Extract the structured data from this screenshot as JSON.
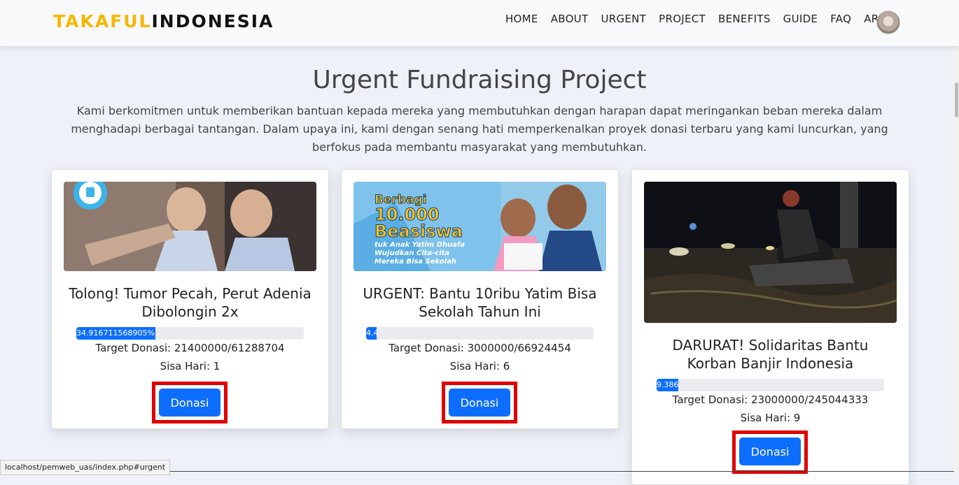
{
  "brand": {
    "part1": "TAKAFUL",
    "part2": "INDONESIA"
  },
  "nav": [
    "HOME",
    "ABOUT",
    "URGENT",
    "PROJECT",
    "BENEFITS",
    "GUIDE",
    "FAQ",
    "ARIMA"
  ],
  "hero": {
    "title": "Urgent Fundraising Project",
    "description": "Kami berkomitmen untuk memberikan bantuan kepada mereka yang membutuhkan dengan harapan dapat meringankan beban mereka dalam menghadapi berbagai tantangan. Dalam upaya ini, kami dengan senang hati memperkenalkan proyek donasi terbaru yang kami luncurkan, yang berfokus pada membantu masyarakat yang membutuhkan."
  },
  "cards": [
    {
      "title": "Tolong! Tumor Pecah, Perut Adenia Dibolongin 2x",
      "progress_label": "34.916711568905%",
      "progress_pct": 34.92,
      "target": "Target Donasi: 21400000/61288704",
      "days": "Sisa Hari: 1",
      "button": "Donasi"
    },
    {
      "title": "URGENT: Bantu 10ribu Yatim Bisa Sekolah Tahun Ini",
      "progress_label": "4.4",
      "progress_pct": 4.48,
      "target": "Target Donasi: 3000000/66924454",
      "days": "Sisa Hari: 6",
      "button": "Donasi",
      "image_text": [
        "Berbagi",
        "10.000",
        "Beasiswa",
        "tuk Anak Yatim Dhuafa",
        "Wujudkan Cita-cita",
        "Mereka Bisa Sekolah"
      ]
    },
    {
      "title": "DARURAT! Solidaritas Bantu Korban Banjir Indonesia",
      "progress_label": "9.386",
      "progress_pct": 9.39,
      "target": "Target Donasi: 23000000/245044333",
      "days": "Sisa Hari: 9",
      "button": "Donasi"
    }
  ],
  "status_url": "localhost/pemweb_uas/index.php#urgent",
  "colors": {
    "accent": "#0d6efd",
    "brand_yellow": "#f5b700",
    "highlight_red": "#e00000"
  }
}
